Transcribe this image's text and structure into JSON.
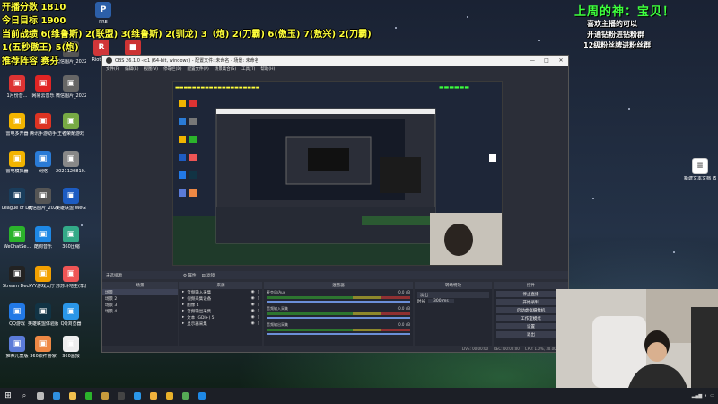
{
  "overlay": {
    "line1": "开播分数 1810",
    "line2": "今日目标 1900",
    "line3": "当前战绩 6(维鲁斯) 2(联盟) 3(维鲁斯) 2(驯龙) 3（炮) 2(刀霸) 6(傲玉) 7(敖兴) 2(刀霸)",
    "line4": "1(五秒傲王) 5(炮)",
    "line5": "推荐阵容 赛芬",
    "god_title": "上周的神：宝贝！",
    "tip1": "喜欢主播的可以",
    "tip2": "开通钻粉进钻粉群",
    "tip3": "12级粉丝牌进粉丝群"
  },
  "desktop_icons": [
    {
      "label": "1月份音... ",
      "icon": "document-icon",
      "color": "#d33"
    },
    {
      "label": "网易云音乐",
      "icon": "music-icon",
      "color": "#e02424"
    },
    {
      "label": "微信图片_2022021...",
      "icon": "image-icon",
      "color": "#666"
    },
    {
      "label": "雷电多开器",
      "icon": "ld-icon",
      "color": "#f2b400"
    },
    {
      "label": "腾讯手游助手",
      "icon": "game-assistant-icon",
      "color": "#d32"
    },
    {
      "label": "王者荣耀游戏",
      "icon": "game-icon",
      "color": "#7a4"
    },
    {
      "label": "雷电模拟器",
      "icon": "ld-player-icon",
      "color": "#f2b400"
    },
    {
      "label": "网络",
      "icon": "network-icon",
      "color": "#2a7bd6"
    },
    {
      "label": "2021120810...",
      "icon": "file-icon",
      "color": "#888"
    },
    {
      "label": "League of Legends",
      "icon": "lol-icon",
      "color": "#1a3d5c"
    },
    {
      "label": "微信图片_2022021...",
      "icon": "image-icon",
      "color": "#555"
    },
    {
      "label": "英雄联盟 WeGame版",
      "icon": "wegame-icon",
      "color": "#1d5cc2"
    },
    {
      "label": "WeChatSe...",
      "icon": "wechat-icon",
      "color": "#2bb32b"
    },
    {
      "label": "酷狗音乐",
      "icon": "kugou-icon",
      "color": "#1e88e5"
    },
    {
      "label": "360压缩",
      "icon": "zip-icon",
      "color": "#3a8"
    },
    {
      "label": "Stream Deck",
      "icon": "stream-deck-icon",
      "color": "#222"
    },
    {
      "label": "YY游戏大厅",
      "icon": "yy-icon",
      "color": "#f2a000"
    },
    {
      "label": "苏苏斗地主(享游)",
      "icon": "cards-icon",
      "color": "#e55"
    },
    {
      "label": "QQ游戏",
      "icon": "qq-game-icon",
      "color": "#2279e6"
    },
    {
      "label": "英雄联盟体验服",
      "icon": "lol-pbe-icon",
      "color": "#134"
    },
    {
      "label": "QQ浏览器",
      "icon": "qq-browser-icon",
      "color": "#2a96e8"
    },
    {
      "label": "推荐儿童版",
      "icon": "kids-icon",
      "color": "#5b7bd8"
    },
    {
      "label": "360软件管家",
      "icon": "software-manager-icon",
      "color": "#e84"
    },
    {
      "label": "360画报",
      "icon": "pictorial-icon",
      "color": "#eee"
    }
  ],
  "top_icons": [
    {
      "label": "PRE",
      "icon": "pre-icon"
    },
    {
      "label": "Riot Cl...",
      "icon": "riot-client-icon"
    },
    {
      "label": "微信图片_2022042...",
      "icon": "image-icon"
    },
    {
      "label": "微信图片_2022021...",
      "icon": "image-icon"
    }
  ],
  "right_icon": {
    "label": "新建文本文档 (5)",
    "icon": "text-document-icon"
  },
  "obs": {
    "title": "OBS 26.1.0 -rc1 (64-bit, windows) - 配置文件: 未命名 - 场景: 未命名",
    "menu": [
      "文件(F)",
      "编辑(E)",
      "视图(V)",
      "停靠栏(D)",
      "配置文件(P)",
      "场景集合(S)",
      "工具(T)",
      "帮助(H)"
    ],
    "no_source": "未选择源",
    "props_label": "属性",
    "filters_label": "滤镜",
    "panels": {
      "scenes": "场景",
      "sources": "来源",
      "mixer": "混音器",
      "transitions": "转场特效",
      "controls": "控件"
    },
    "scenes": [
      "场景",
      "场景 2",
      "场景 3",
      "场景 4"
    ],
    "sources": [
      "音频输入采集",
      "视频采集设备",
      "图像 4",
      "音频输出采集",
      "文本 (GDI+) 5",
      "显示器采集"
    ],
    "mixer": [
      {
        "name": "麦克风/Aux",
        "db": "-0.0 dB"
      },
      {
        "name": "音频输入采集",
        "db": "-0.0 dB"
      },
      {
        "name": "音频输出采集",
        "db": "0.0 dB"
      }
    ],
    "transitions": {
      "type": "淡出",
      "duration_label": "时长",
      "duration": "300 ms"
    },
    "controls": [
      "停止直播",
      "开始录制",
      "启动虚拟摄像机",
      "工作室模式",
      "设置",
      "退出"
    ],
    "status": {
      "live": "LIVE: 00:00:00",
      "rec": "REC: 00:00:00",
      "cpu": "CPU: 1.0%, 30.00 fps"
    }
  },
  "taskbar": {
    "start": "⊞",
    "search": "⌕",
    "apps": [
      {
        "name": "task-view-icon",
        "color": "#bbb"
      },
      {
        "name": "edge-icon",
        "color": "#2f8fdf"
      },
      {
        "name": "file-explorer-icon",
        "color": "#f2c14e"
      },
      {
        "name": "wechat-icon",
        "color": "#2bb32b"
      },
      {
        "name": "league-icon",
        "color": "#c89b3c"
      },
      {
        "name": "obs-icon",
        "color": "#444"
      },
      {
        "name": "qq-browser-icon",
        "color": "#2a96e8"
      },
      {
        "name": "folder-icon",
        "color": "#f0b23c"
      },
      {
        "name": "app-icon",
        "color": "#e8b12a"
      },
      {
        "name": "media-icon",
        "color": "#5a5"
      },
      {
        "name": "kugou-icon",
        "color": "#1e88e5"
      }
    ]
  }
}
